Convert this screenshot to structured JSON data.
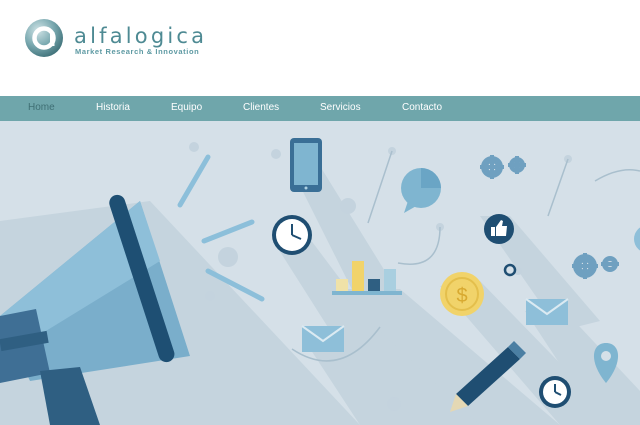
{
  "brand": {
    "name": "alfalogica",
    "tagline": "Market Research & Innovation",
    "logo_icon": "alfalogica-logo-icon"
  },
  "nav": {
    "items": [
      {
        "label": "Home",
        "active": true
      },
      {
        "label": "Historia",
        "active": false
      },
      {
        "label": "Equipo",
        "active": false
      },
      {
        "label": "Clientes",
        "active": false
      },
      {
        "label": "Servicios",
        "active": false
      },
      {
        "label": "Contacto",
        "active": false
      }
    ]
  },
  "hero": {
    "icons": [
      "megaphone-icon",
      "smartphone-icon",
      "speech-bubble-icon",
      "gears-icon",
      "clock-icon",
      "thumbs-up-icon",
      "bar-chart-icon",
      "dollar-coin-icon",
      "envelope-icon",
      "pencil-icon",
      "location-pin-icon"
    ],
    "coin_symbol": "$"
  },
  "colors": {
    "nav_bg": "#6fa6ab",
    "nav_active": "#3f6f74",
    "brand": "#4e8a93",
    "hero_bg": "#d5e0e8",
    "accent_dark": "#2f5f82",
    "accent_light": "#7fb5d0",
    "coin": "#f1d36a"
  }
}
